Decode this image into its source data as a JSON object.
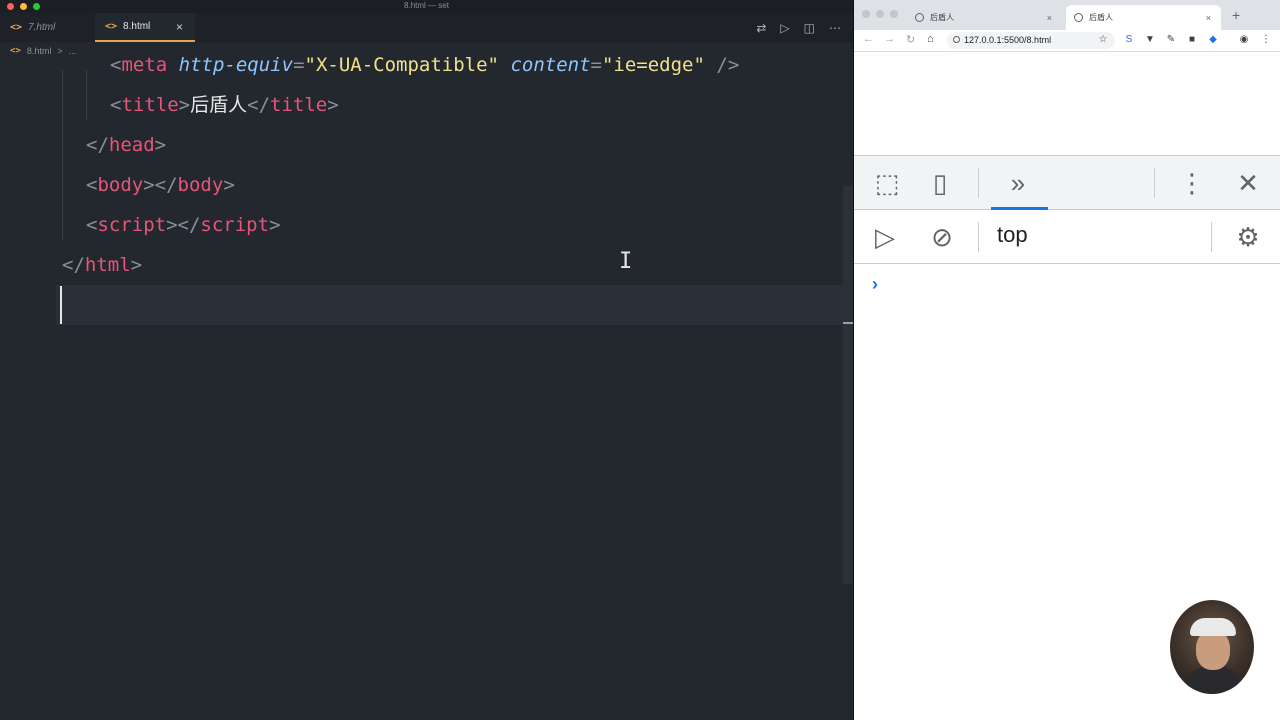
{
  "editor": {
    "window_title": "8.html — set",
    "tabs": [
      {
        "label": "7.html",
        "icon": "code-icon"
      },
      {
        "label": "8.html",
        "icon": "code-icon",
        "close": "×"
      }
    ],
    "toolbar_icons": [
      "compare-icon",
      "run-icon",
      "split-icon",
      "more-icon"
    ],
    "toolbar_glyphs": {
      "compare": "⇄",
      "run": "▷",
      "split": "◫",
      "more": "⋯"
    },
    "breadcrumb": {
      "file": "8.html",
      "sep": ">",
      "rest": "..."
    },
    "code_lines": {
      "l1_open": "<",
      "l1_tag": "meta",
      "l1_attr1": "http-equiv",
      "l1_eq1": "=",
      "l1_val1": "\"X-UA-Compatible\"",
      "l1_attr2": "content",
      "l1_eq2": "=",
      "l1_val2": "\"ie=edge\"",
      "l1_close": "/>",
      "l2_open": "<",
      "l2_tag": "title",
      "l2_gt": ">",
      "l2_text": "后盾人",
      "l2_close_open": "</",
      "l2_close_tag": "title",
      "l2_close_gt": ">",
      "l3_open": "</",
      "l3_tag": "head",
      "l3_gt": ">",
      "l4_open": "<",
      "l4_tag": "body",
      "l4_gt": "></",
      "l4_close_tag": "body",
      "l4_close_gt": ">",
      "l5_open": "<",
      "l5_tag": "script",
      "l5_gt": "></",
      "l5_close_tag": "script",
      "l5_close_gt": ">",
      "l6_open": "</",
      "l6_tag": "html",
      "l6_gt": ">"
    }
  },
  "browser": {
    "tabs": [
      {
        "label": "后盾人",
        "close": "×"
      },
      {
        "label": "后盾人",
        "close": "×"
      }
    ],
    "new_tab": "+",
    "nav": {
      "back": "←",
      "forward": "→",
      "reload": "↻",
      "home": "⌂"
    },
    "url": "127.0.0.1:5500/8.html",
    "extensions": [
      "☆",
      "S",
      "▼",
      "✎",
      "■",
      "◆",
      "◉",
      "⋮"
    ],
    "devtools": {
      "inspect_glyph": "⬚",
      "device_glyph": "▯",
      "more_panels": "»",
      "menu": "⋮",
      "close": "✕",
      "sidebar_glyph": "▷",
      "clear_glyph": "⊘",
      "context": "top",
      "settings_glyph": "⚙",
      "prompt": "›"
    }
  }
}
